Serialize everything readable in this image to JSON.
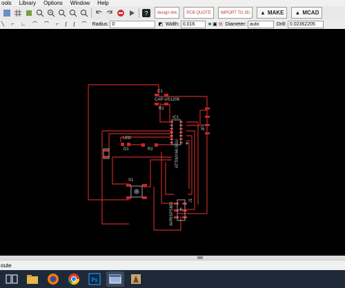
{
  "menu": [
    "ools",
    "Library",
    "Options",
    "Window",
    "Help"
  ],
  "toolbar_buttons": {
    "sparkfun": "design link",
    "pcb_quote": "PCB QUOTE",
    "brd3d": "IMPORT TO 3D",
    "make": "MAKE",
    "mcad": "MCAD"
  },
  "params": {
    "radius_label": "Radius:",
    "radius_value": "0",
    "width_label": "Width:",
    "width_value": "0.016",
    "diameter_label": "Diameter:",
    "diameter_value": "auto",
    "drill_label": "Drill:",
    "drill_value": "0.02362205"
  },
  "labels": {
    "c1": "C1",
    "c1_value": "CAP-US1206",
    "r1": "R1",
    "ic1": "IC1",
    "ic1_part": "ATTINY44-SSU",
    "led": "LED",
    "d1": "D1",
    "r2": "R2",
    "s1": "S1",
    "j1": "J1",
    "avrisp": "AVRISPSMD",
    "jp1": "JP1"
  },
  "status": {
    "text": "oute"
  },
  "colors": {
    "trace": "#c62828",
    "pad": "#c62828",
    "label": "#cfcfcf",
    "canvas": "#000000"
  }
}
